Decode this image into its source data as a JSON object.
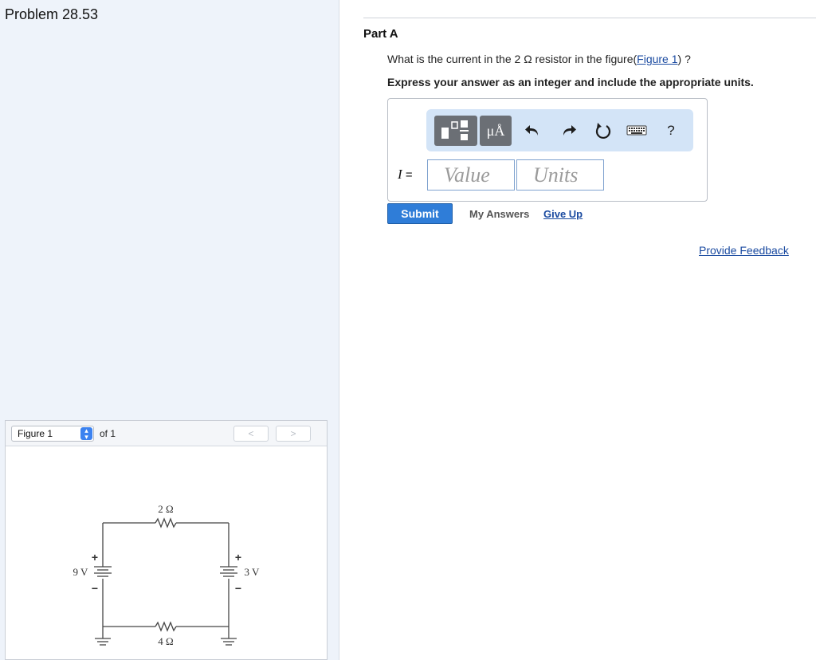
{
  "problem": {
    "title": "Problem 28.53"
  },
  "figure_panel": {
    "selected": "Figure 1",
    "of_label": "of 1",
    "prev_label": "<",
    "next_label": ">",
    "circuit": {
      "top_resistor": "2 Ω",
      "bottom_resistor": "4 Ω",
      "left_battery": "9 V",
      "right_battery": "3 V",
      "plus": "+",
      "minus": "−"
    }
  },
  "part": {
    "label": "Part A",
    "question_prefix": "What is the current in the 2 Ω resistor in the figure(",
    "question_link": "Figure 1",
    "question_suffix": ") ?",
    "instruction": "Express your answer as an integer and include the appropriate units."
  },
  "toolbar": {
    "units_label": "μÅ",
    "help_label": "?",
    "icons": [
      "templates-icon",
      "units-icon",
      "undo-icon",
      "redo-icon",
      "reset-icon",
      "keyboard-icon",
      "help-icon"
    ]
  },
  "answer": {
    "variable": "I",
    "equals": "=",
    "value_placeholder": "Value",
    "units_placeholder": "Units"
  },
  "actions": {
    "submit": "Submit",
    "my_answers": "My Answers",
    "give_up": "Give Up",
    "feedback": "Provide Feedback"
  },
  "colors": {
    "accent": "#2f7dd8",
    "link": "#1a4aa0",
    "left_panel_bg": "#eef3fa",
    "toolbar_bg": "#d3e4f7"
  }
}
